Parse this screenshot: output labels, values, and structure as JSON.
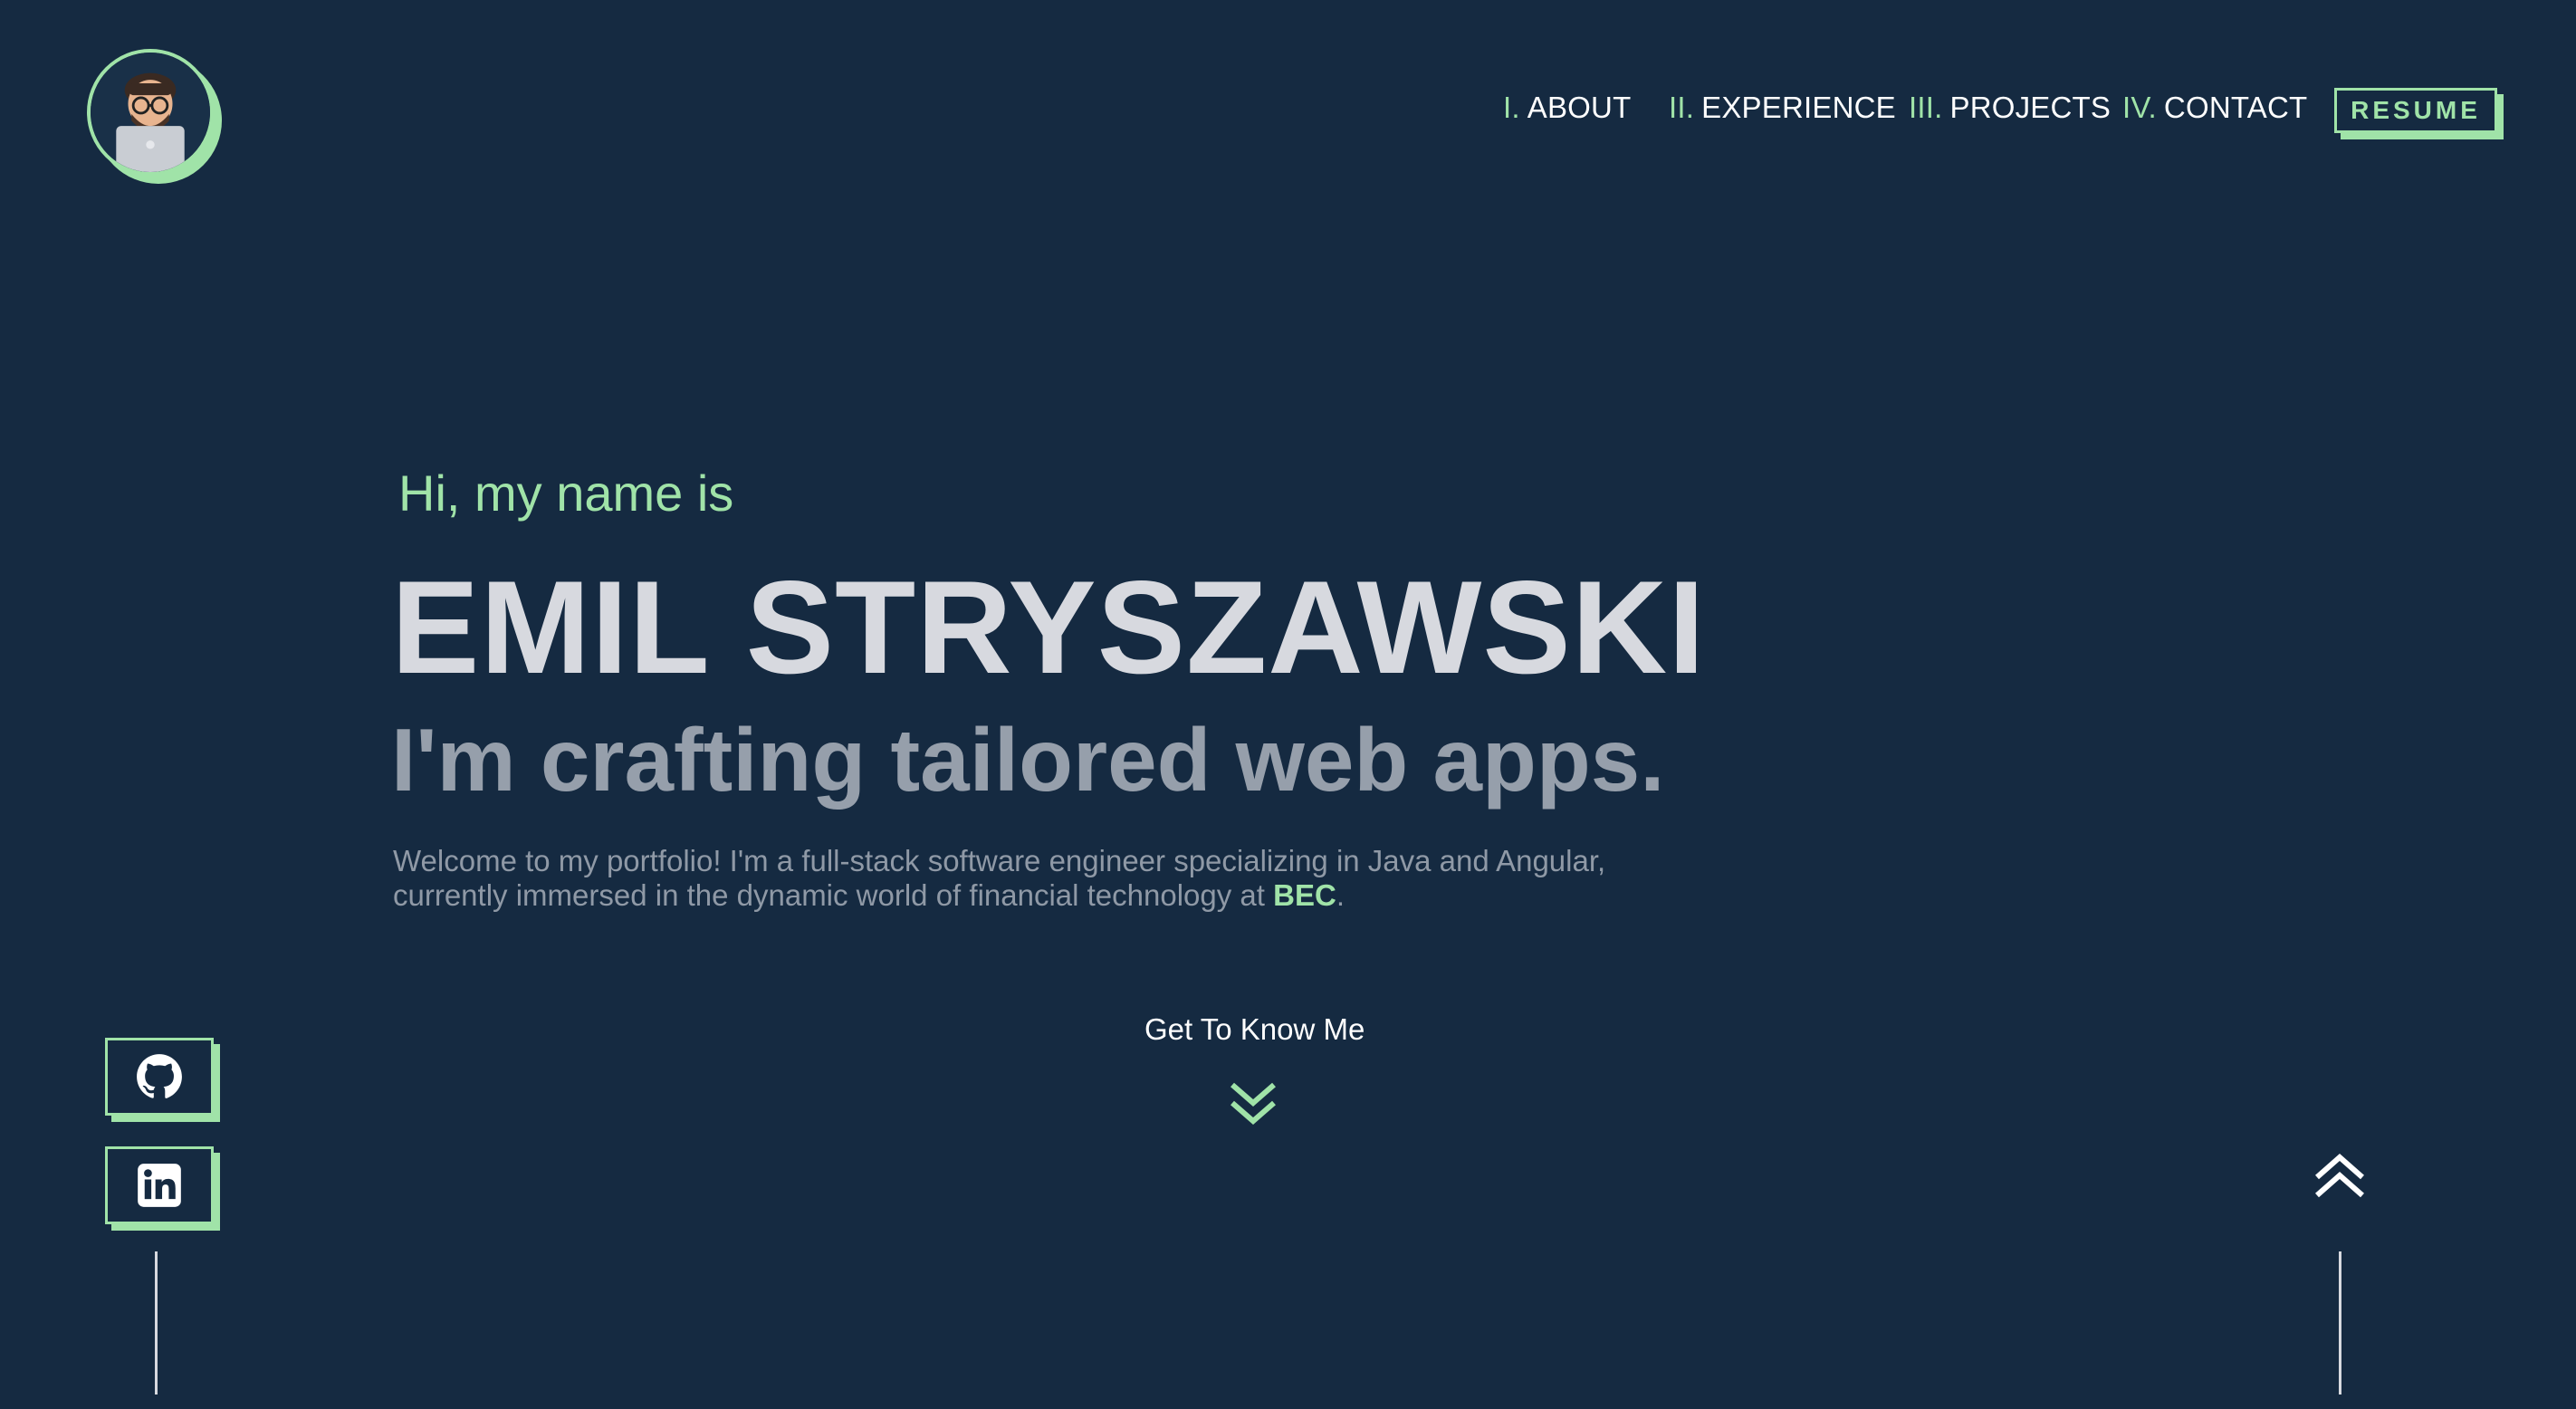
{
  "nav": {
    "items": [
      {
        "num": "I.",
        "label": "ABOUT"
      },
      {
        "num": "II.",
        "label": "EXPERIENCE"
      },
      {
        "num": "III.",
        "label": "PROJECTS"
      },
      {
        "num": "IV.",
        "label": "CONTACT"
      }
    ],
    "resume_label": "RESUME"
  },
  "hero": {
    "greeting": "Hi, my name is",
    "name": "EMIL STRYSZAWSKI",
    "tagline": "I'm crafting tailored web apps.",
    "intro_before": "Welcome to my portfolio! I'm a full-stack software engineer specializing in Java and Angular, currently immersed in the dynamic world of financial technology at ",
    "intro_highlight": "BEC",
    "intro_after": "."
  },
  "cta": {
    "label": "Get To Know Me"
  },
  "social": {
    "github": "github-icon",
    "linkedin": "linkedin-icon"
  },
  "colors": {
    "background": "#152a41",
    "accent": "#a0e3a8",
    "text": "#d7d9df",
    "muted": "#969fab"
  }
}
